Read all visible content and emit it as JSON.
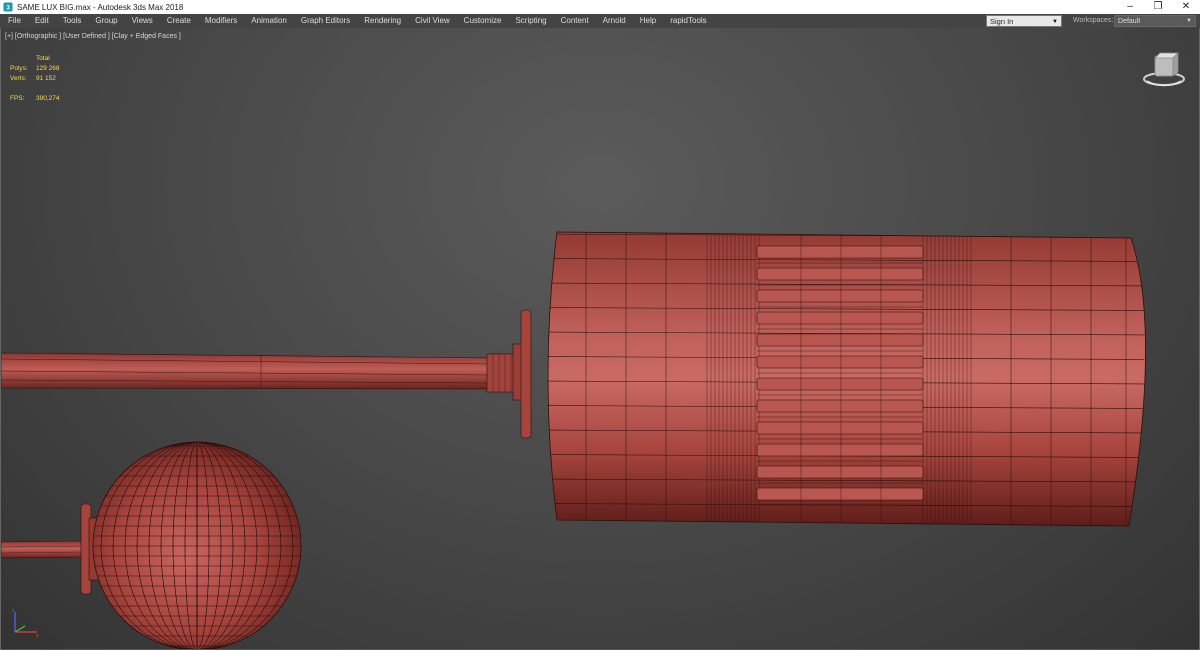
{
  "window": {
    "title": "SAME LUX BIG.max - Autodesk 3ds Max 2018",
    "controls": [
      "–",
      "❐",
      "✕"
    ]
  },
  "menu": {
    "items": [
      "File",
      "Edit",
      "Tools",
      "Group",
      "Views",
      "Create",
      "Modifiers",
      "Animation",
      "Graph Editors",
      "Rendering",
      "Civil View",
      "Customize",
      "Scripting",
      "Content",
      "Arnold",
      "Help",
      "rapidTools"
    ],
    "signin_label": "Sign In",
    "workspaces_label": "Workspaces:",
    "workspace_value": "Default"
  },
  "viewport": {
    "label": "[+] [Orthographic ] [User Defined ] [Clay + Edged Faces ]",
    "stats": {
      "total_label": "Total",
      "polys_label": "Polys:",
      "polys_value": "129 268",
      "verts_label": "Verts:",
      "verts_value": "91 152",
      "fps_label": "FPS:",
      "fps_value": "390,274"
    }
  },
  "colors": {
    "mesh": "#a8443d",
    "mesh_dark": "#6e2420",
    "wire": "#2a0f0d",
    "stats_text": "#ffd84a",
    "menubar": "#444444",
    "titlebar": "#ffffff"
  },
  "icons": {
    "app": "3ds-max-icon",
    "viewcube": "viewcube-icon",
    "axis": "axis-tripod-icon"
  }
}
